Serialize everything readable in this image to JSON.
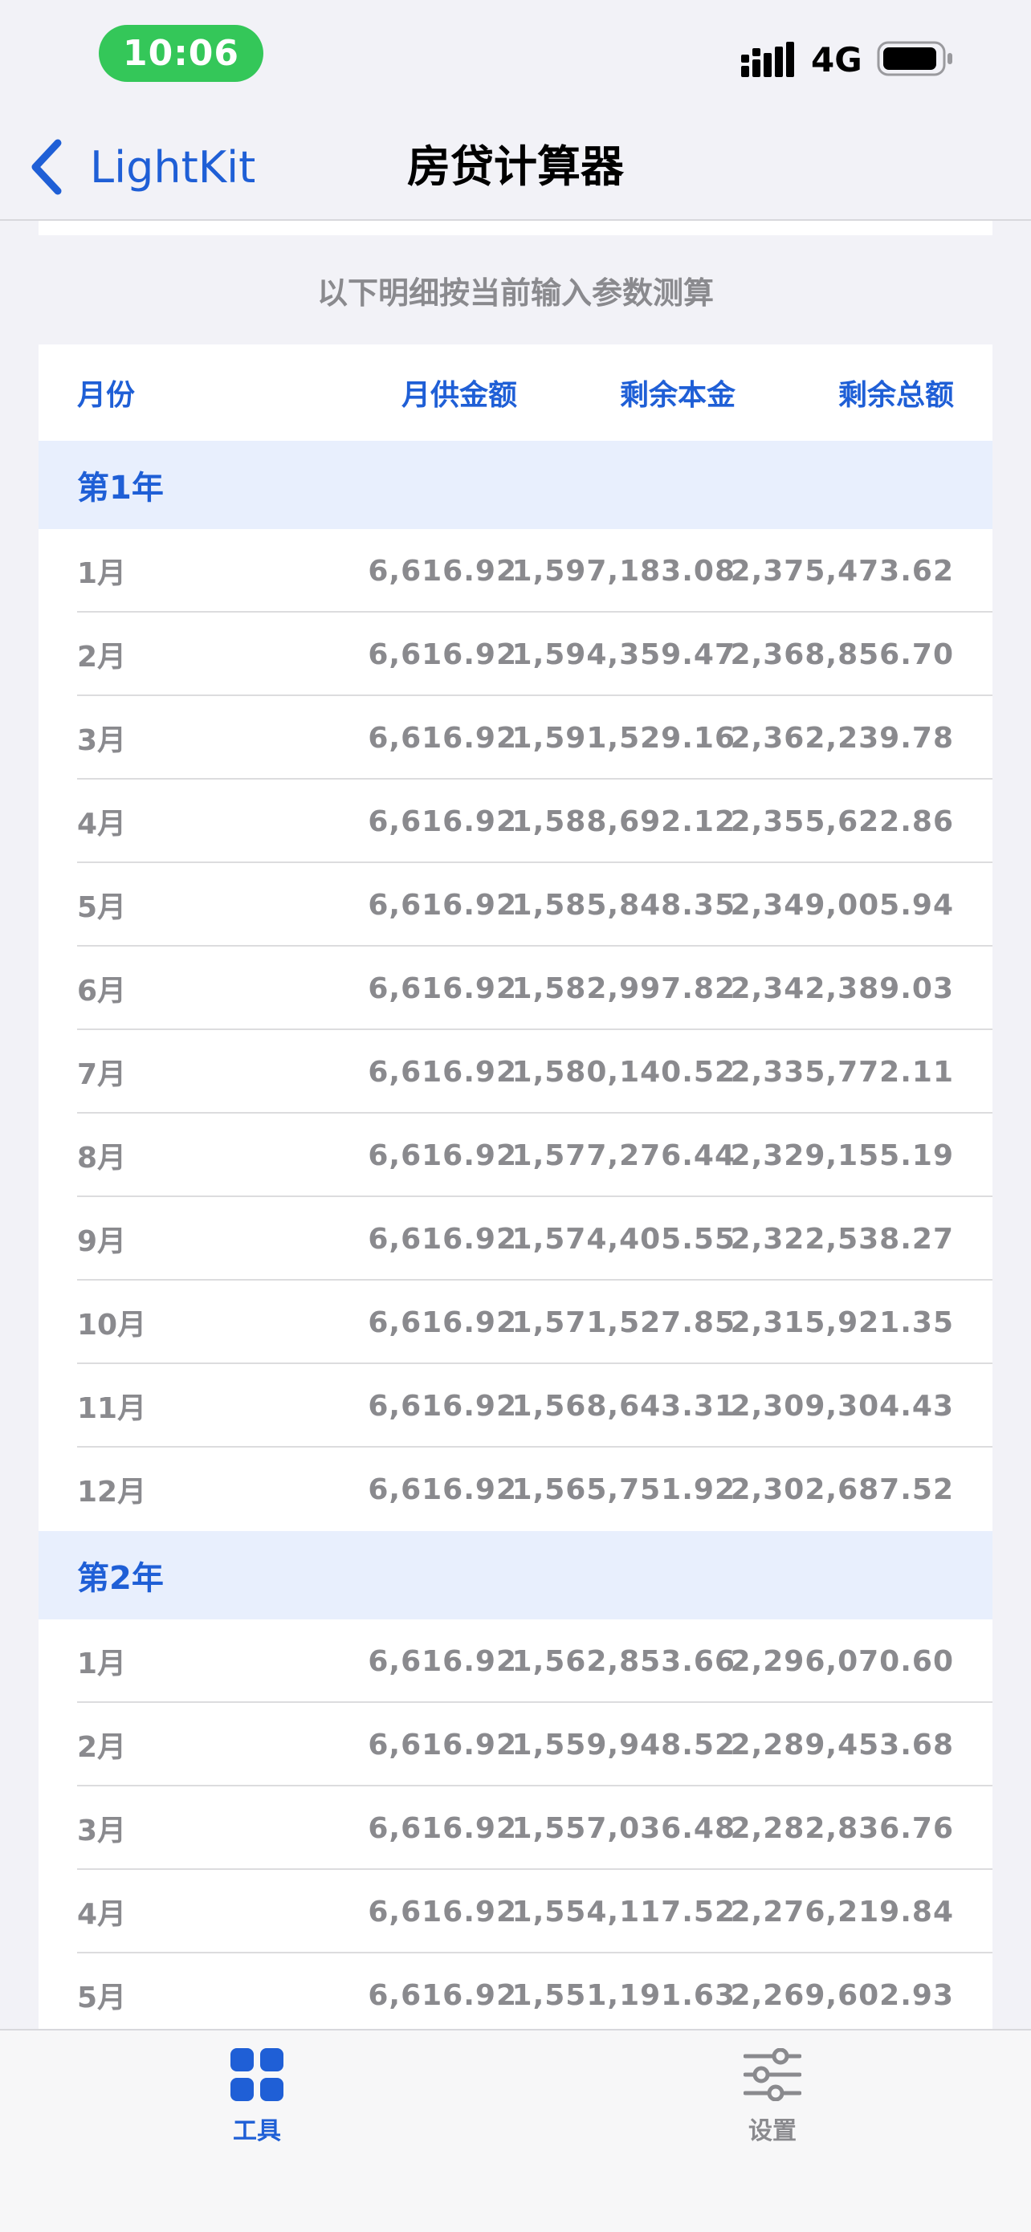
{
  "status_bar": {
    "time": "10:06",
    "network": "4G"
  },
  "nav": {
    "back_label": "LightKit",
    "title": "房贷计算器"
  },
  "note": "以下明细按当前输入参数测算",
  "table": {
    "headers": {
      "month": "月份",
      "payment": "月供金额",
      "principal": "剩余本金",
      "total": "剩余总额"
    },
    "years": [
      {
        "label": "第1年",
        "rows": [
          {
            "month": "1月",
            "payment": "6,616.92",
            "principal": "1,597,183.08",
            "total": "2,375,473.62"
          },
          {
            "month": "2月",
            "payment": "6,616.92",
            "principal": "1,594,359.47",
            "total": "2,368,856.70"
          },
          {
            "month": "3月",
            "payment": "6,616.92",
            "principal": "1,591,529.16",
            "total": "2,362,239.78"
          },
          {
            "month": "4月",
            "payment": "6,616.92",
            "principal": "1,588,692.12",
            "total": "2,355,622.86"
          },
          {
            "month": "5月",
            "payment": "6,616.92",
            "principal": "1,585,848.35",
            "total": "2,349,005.94"
          },
          {
            "month": "6月",
            "payment": "6,616.92",
            "principal": "1,582,997.82",
            "total": "2,342,389.03"
          },
          {
            "month": "7月",
            "payment": "6,616.92",
            "principal": "1,580,140.52",
            "total": "2,335,772.11"
          },
          {
            "month": "8月",
            "payment": "6,616.92",
            "principal": "1,577,276.44",
            "total": "2,329,155.19"
          },
          {
            "month": "9月",
            "payment": "6,616.92",
            "principal": "1,574,405.55",
            "total": "2,322,538.27"
          },
          {
            "month": "10月",
            "payment": "6,616.92",
            "principal": "1,571,527.85",
            "total": "2,315,921.35"
          },
          {
            "month": "11月",
            "payment": "6,616.92",
            "principal": "1,568,643.31",
            "total": "2,309,304.43"
          },
          {
            "month": "12月",
            "payment": "6,616.92",
            "principal": "1,565,751.92",
            "total": "2,302,687.52"
          }
        ]
      },
      {
        "label": "第2年",
        "rows": [
          {
            "month": "1月",
            "payment": "6,616.92",
            "principal": "1,562,853.66",
            "total": "2,296,070.60"
          },
          {
            "month": "2月",
            "payment": "6,616.92",
            "principal": "1,559,948.52",
            "total": "2,289,453.68"
          },
          {
            "month": "3月",
            "payment": "6,616.92",
            "principal": "1,557,036.48",
            "total": "2,282,836.76"
          },
          {
            "month": "4月",
            "payment": "6,616.92",
            "principal": "1,554,117.52",
            "total": "2,276,219.84"
          },
          {
            "month": "5月",
            "payment": "6,616.92",
            "principal": "1,551,191.63",
            "total": "2,269,602.93"
          }
        ]
      }
    ]
  },
  "tab_bar": {
    "tools_label": "工具",
    "settings_label": "设置",
    "tools_icon": "grid-icon",
    "settings_icon": "sliders-icon"
  },
  "colors": {
    "accent": "#1f5fd6",
    "section_bg": "#e8effd",
    "time_pill": "#34c759",
    "muted_text": "#8a8a8e",
    "background": "#f2f2f7"
  }
}
